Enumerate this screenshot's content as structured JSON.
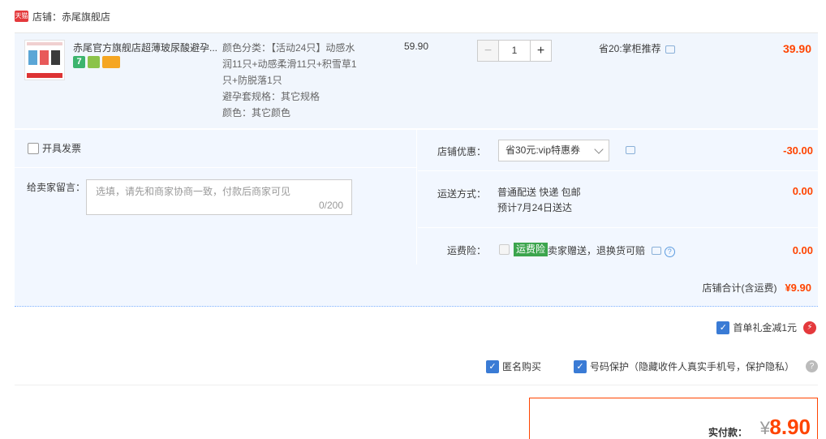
{
  "shop": {
    "badge": "天猫",
    "name": "店铺：赤尾旗舰店"
  },
  "item": {
    "title": "赤尾官方旗舰店超薄玻尿酸避孕...",
    "badge_seven": "7",
    "sku_lines": [
      "颜色分类：【活动24只】动感水",
      "润11只+动感柔滑11只+积雪草1",
      "只+防脱落1只",
      "避孕套规格：其它规格",
      "颜色：其它颜色"
    ],
    "unit_price": "59.90",
    "qty_minus": "−",
    "qty_value": "1",
    "qty_plus": "+",
    "promo": "省20:掌柜推荐",
    "total": "39.90"
  },
  "invoice": {
    "label": "开具发票"
  },
  "message": {
    "label": "给卖家留言：",
    "placeholder": "选填，请先和商家协商一致，付款后商家可见",
    "count": "0/200"
  },
  "discount": {
    "label": "店铺优惠：",
    "selected": "省30元:vip特惠券",
    "value": "-30.00"
  },
  "shipping": {
    "label": "运送方式：",
    "method": "普通配送 快递 包邮",
    "eta": "预计7月24日送达",
    "value": "0.00"
  },
  "insurance": {
    "label": "运费险：",
    "tag": "运费险",
    "text": "卖家赠送，退换货可赔",
    "help": "?",
    "value": "0.00"
  },
  "shop_total": {
    "label": "店铺合计(含运费)",
    "value": "¥9.90"
  },
  "bonus": {
    "label": "首单礼金减1元",
    "check": "✓",
    "bolt": "⚡"
  },
  "privacy": {
    "anonymous": "匿名购买",
    "phone": "号码保护（隐藏收件人真实手机号，保护隐私）",
    "check": "✓",
    "help": "?"
  },
  "payment": {
    "label": "实付款：",
    "currency": "¥",
    "amount": "8.90"
  },
  "colors": {
    "accent": "#ff4400",
    "blue": "#3a7bd5",
    "panel": "#f2f7ff"
  }
}
